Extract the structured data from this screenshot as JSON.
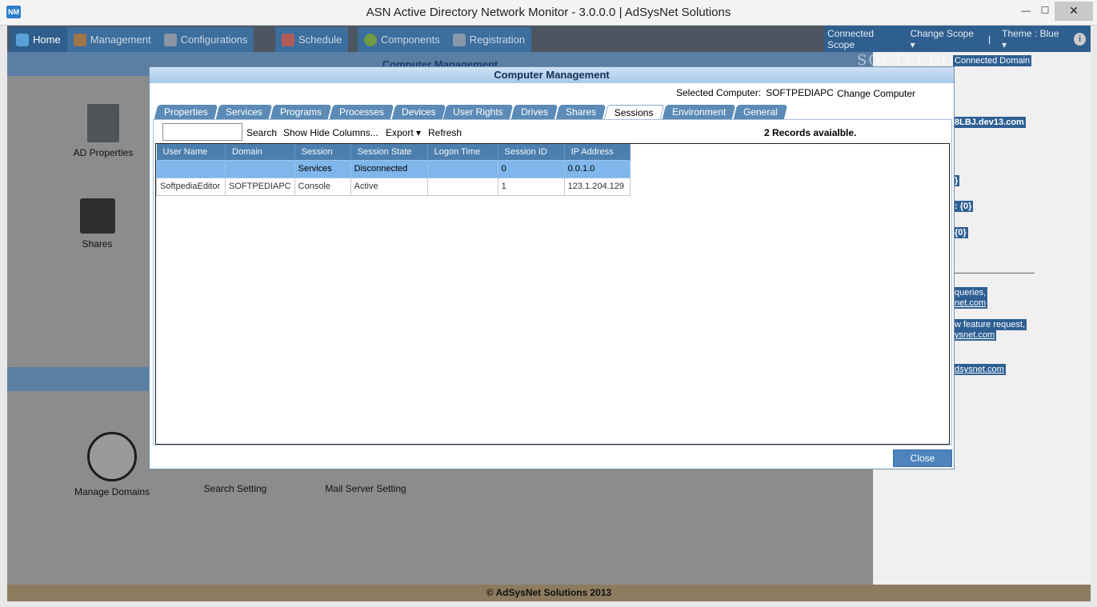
{
  "window": {
    "title": "ASN Active Directory Network Monitor - 3.0.0.0 | AdSysNet Solutions",
    "app_icon": "NM",
    "min": "—",
    "max": "☐",
    "close": "✕"
  },
  "menu": {
    "home": "Home",
    "management": "Management",
    "configurations": "Configurations",
    "schedule": "Schedule",
    "components": "Components",
    "registration": "Registration"
  },
  "right_menu": {
    "connected_scope": "Connected Scope",
    "change_scope": "Change Scope ▾",
    "separator": "|",
    "theme": "Theme : Blue ▾",
    "info": "i"
  },
  "background": {
    "band_title": "Computer Management",
    "tiles": {
      "ad_properties": "AD Properties",
      "shares": "Shares",
      "manage_domains": "Manage Domains",
      "search_setting": "Search Setting",
      "mail_server_setting": "Mail Server Setting"
    },
    "side": {
      "watermark": "SOFTPEDIA",
      "connected_domain": "Connected Domain",
      "domain_fragment": "8LBJ.dev13.com",
      "brace1": "}",
      "count1": ": {0}",
      "count2": "{0}",
      "queries": "queries,",
      "net1": "net.com",
      "feature": "w feature request,",
      "net2": "ysnet.com",
      "net3": "dsysnet.com"
    },
    "footer": "© AdSysNet Solutions 2013"
  },
  "modal": {
    "title": "Computer Management",
    "selected_computer_label": "Selected Computer:",
    "selected_computer_value": "SOFTPEDIAPC",
    "change_computer": "Change Computer",
    "tabs": [
      "Properties",
      "Services",
      "Programs",
      "Processes",
      "Devices",
      "User Rights",
      "Drives",
      "Shares",
      "Sessions",
      "Environment",
      "General"
    ],
    "active_tab": "Sessions",
    "toolbar": {
      "search_value": "",
      "search": "Search",
      "show_hide_columns": "Show Hide Columns...",
      "export": "Export ▾",
      "refresh": "Refresh",
      "records": "2 Records avaialble."
    },
    "columns": [
      "User Name",
      "Domain",
      "Session",
      "Session State",
      "Logon Time",
      "Session ID",
      "IP Address"
    ],
    "rows": [
      [
        "",
        "",
        "Services",
        "Disconnected",
        "",
        "0",
        "0.0.1.0"
      ],
      [
        "SoftpediaEditor",
        "SOFTPEDIAPC",
        "Console",
        "Active",
        "",
        "1",
        "123.1.204.129"
      ]
    ],
    "close_button": "Close"
  },
  "colors": {
    "menu_bar": "#3c6e9e",
    "grid_header": "#4d7fae",
    "selected_row": "#7fb6ec"
  }
}
